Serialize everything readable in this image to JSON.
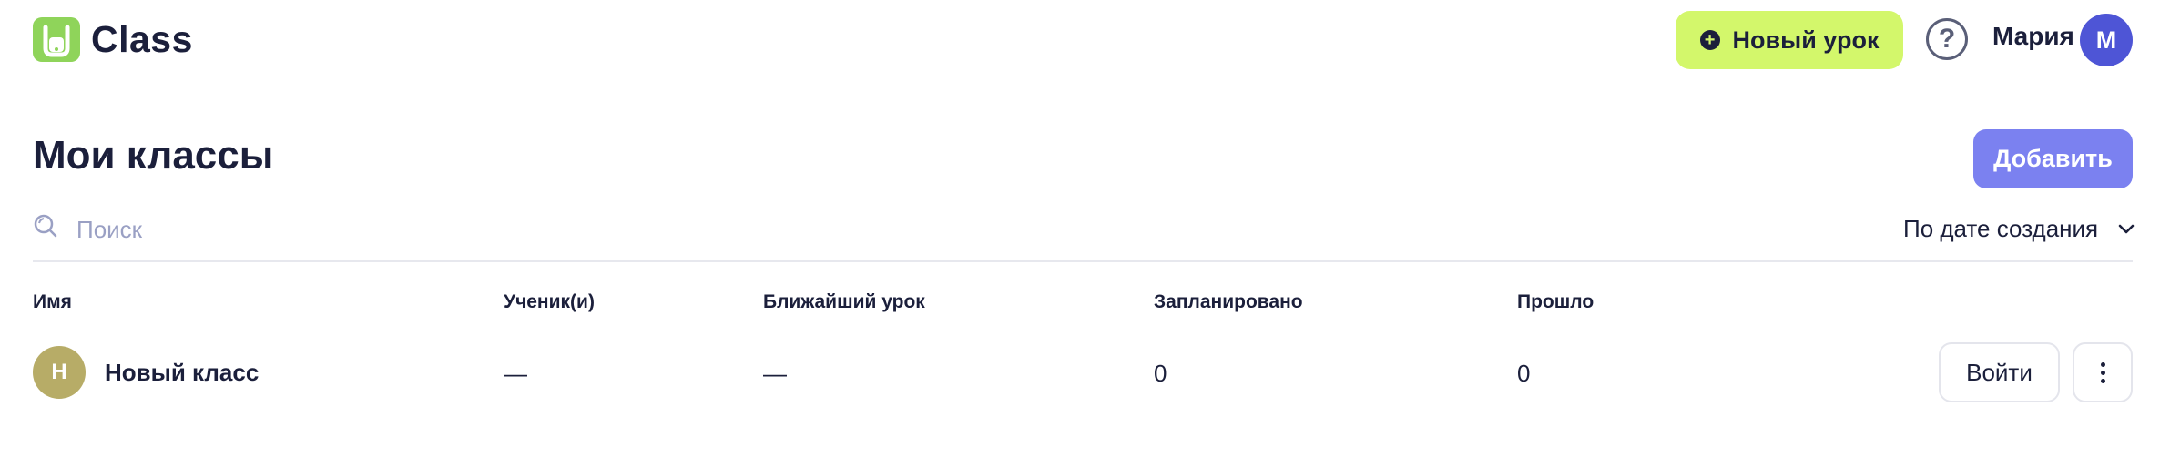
{
  "header": {
    "app_name": "Class",
    "new_lesson_label": "Новый урок",
    "help_symbol": "?",
    "user_name": "Мария",
    "user_initial": "М"
  },
  "main": {
    "title": "Мои классы",
    "add_label": "Добавить",
    "search": {
      "placeholder": "Поиск",
      "value": ""
    },
    "sort_label": "По дате создания"
  },
  "table": {
    "columns": [
      "Имя",
      "Ученик(и)",
      "Ближайший урок",
      "Запланировано",
      "Прошло"
    ],
    "rows": [
      {
        "initial": "Н",
        "name": "Новый класс",
        "students": "—",
        "next_lesson": "—",
        "scheduled": "0",
        "past": "0",
        "enter_label": "Войти"
      }
    ]
  },
  "colors": {
    "accent_green": "#d3f76b",
    "logo_green": "#8fd45a",
    "primary_purple": "#7b81f0",
    "avatar_blue": "#4e55d6",
    "class_avatar": "#b7ac67",
    "text_dark": "#1b1f3b"
  },
  "icons": [
    "logo-icon",
    "plus-circle-icon",
    "help-icon",
    "search-icon",
    "chevron-down-icon",
    "more-vertical-icon"
  ]
}
